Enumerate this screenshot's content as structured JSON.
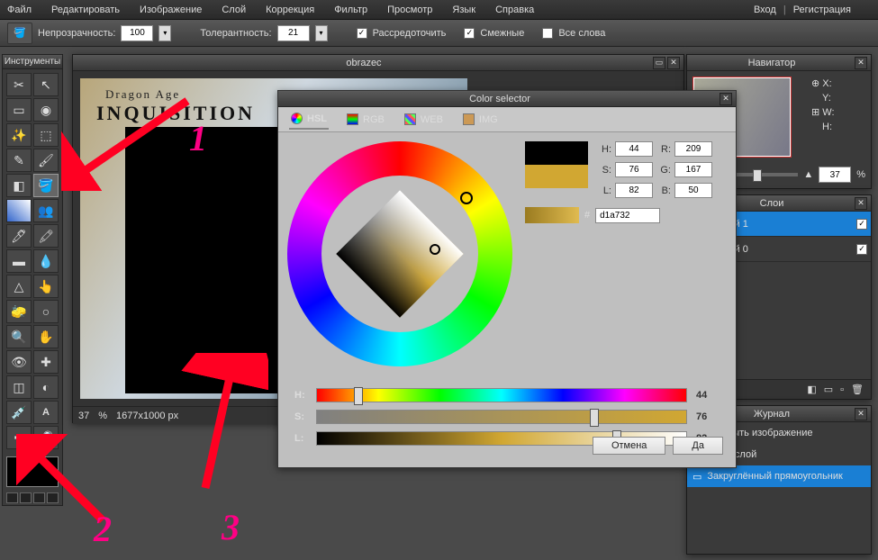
{
  "menu": {
    "items": [
      "Файл",
      "Редактировать",
      "Изображение",
      "Слой",
      "Коррекция",
      "Фильтр",
      "Просмотр",
      "Язык",
      "Справка"
    ],
    "right": [
      "Вход",
      "Регистрация"
    ]
  },
  "options": {
    "opacity_label": "Непрозрачность:",
    "opacity": "100",
    "tolerance_label": "Толерантность:",
    "tolerance": "21",
    "cb1": "Рассредоточить",
    "cb2": "Смежные",
    "cb3": "Все слова"
  },
  "tools_title": "Инструменты",
  "doc": {
    "title": "obrazec",
    "logo1": "Dragon Age",
    "logo2": "INQUISITION",
    "zoom": "37",
    "pct": "%",
    "dims": "1677x1000 px"
  },
  "nav": {
    "title": "Навигатор",
    "x": "X:",
    "y": "Y:",
    "w": "W:",
    "h": "H:",
    "zoom": "37",
    "pct": "%"
  },
  "layers": {
    "title": "Слои",
    "items": [
      {
        "name": "Слой 1"
      },
      {
        "name": "Слой 0"
      }
    ]
  },
  "history": {
    "title": "Журнал",
    "items": [
      "Открыть изображение",
      "Новый слой",
      "Закруглённый прямоугольник"
    ]
  },
  "color": {
    "title": "Color selector",
    "tabs": [
      "HSL",
      "RGB",
      "WEB",
      "IMG"
    ],
    "h": "44",
    "s": "76",
    "l": "82",
    "r": "209",
    "g": "167",
    "b": "50",
    "hex": "d1a732",
    "h_lab": "H:",
    "s_lab": "S:",
    "l_lab": "L:",
    "r_lab": "R:",
    "g_lab": "G:",
    "b_lab": "B:",
    "hash": "#",
    "sl_h": "H:",
    "sl_s": "S:",
    "sl_l": "L:",
    "cancel": "Отмена",
    "ok": "Да"
  },
  "annotations": {
    "n1": "1",
    "n2": "2",
    "n3": "3"
  }
}
